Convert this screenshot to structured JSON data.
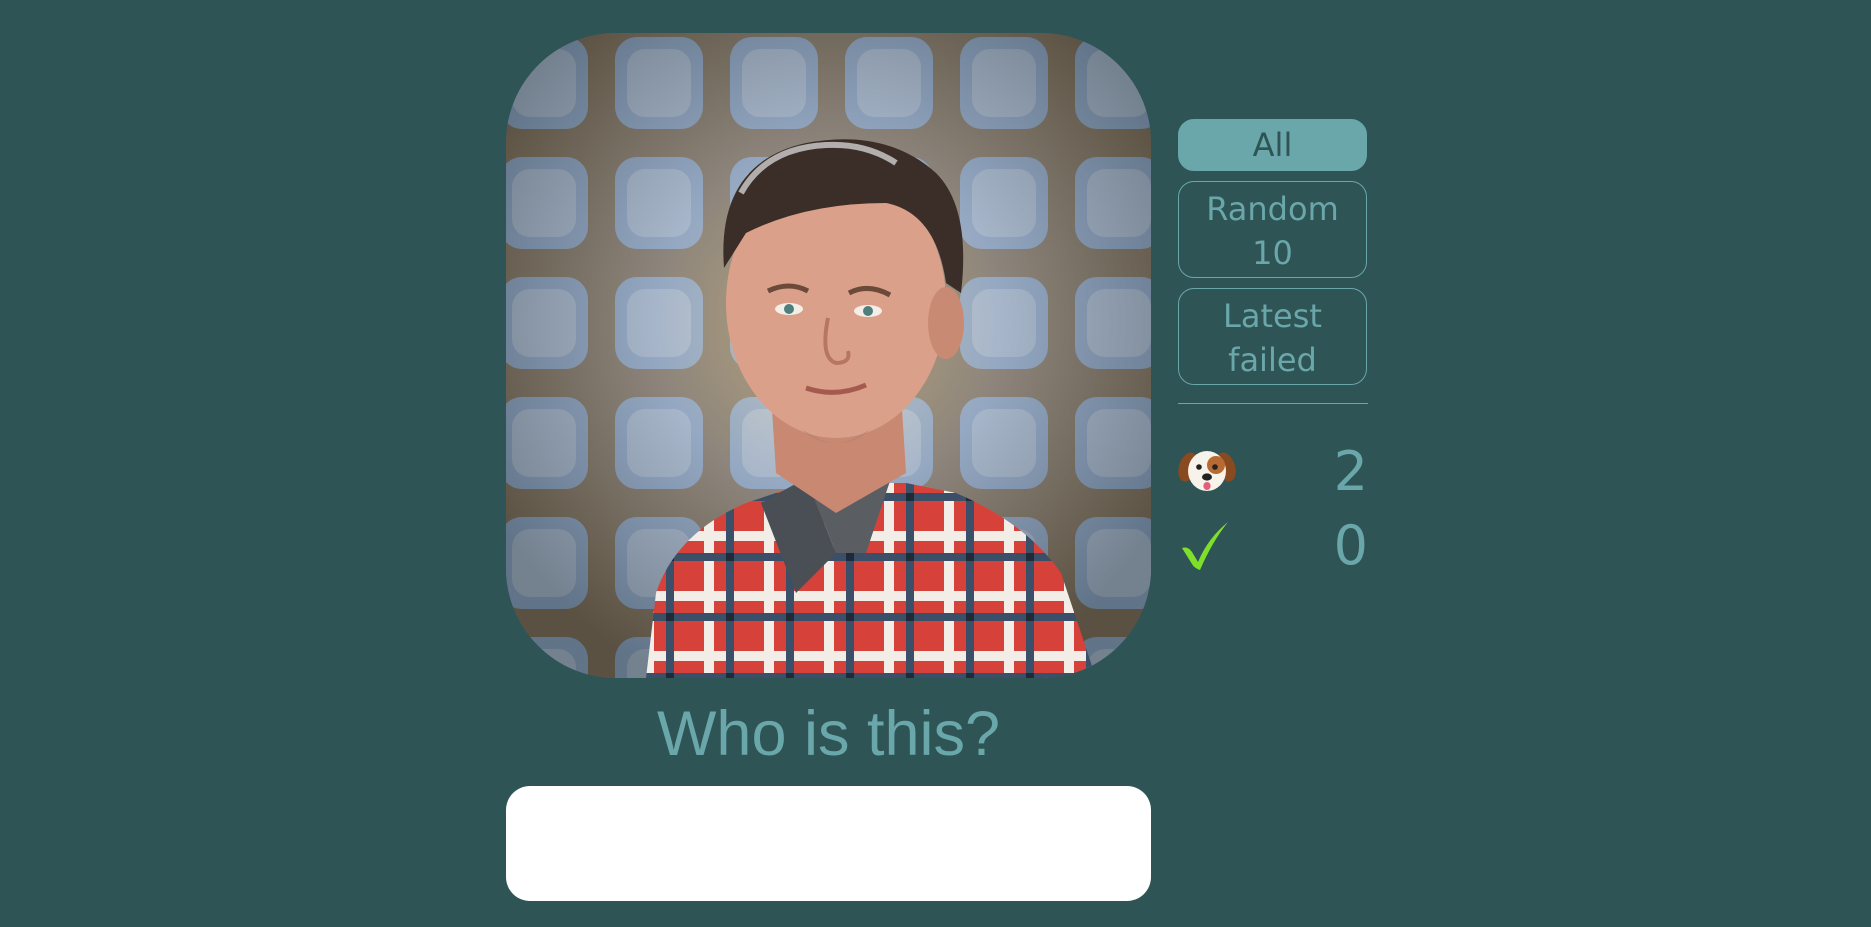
{
  "portrait": {
    "alt": "Portrait of a man in a plaid shirt"
  },
  "quiz": {
    "question": "Who is this?",
    "answer_value": "",
    "answer_placeholder": ""
  },
  "modes": [
    {
      "label": "All",
      "active": true
    },
    {
      "label": "Random 10",
      "active": false
    },
    {
      "label": "Latest failed",
      "active": false
    }
  ],
  "stats": {
    "wrong": {
      "icon": "puppy-face-icon",
      "value": "2"
    },
    "correct": {
      "icon": "check-mark-icon",
      "value": "0"
    }
  },
  "colors": {
    "background": "#2f5455",
    "accent": "#6aa7aa",
    "input": "#ffffff",
    "check": "#7ee02a"
  }
}
